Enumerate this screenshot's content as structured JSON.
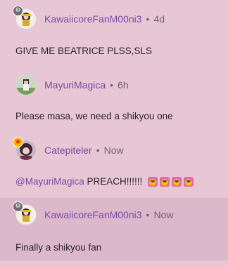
{
  "comments": [
    {
      "username": "KawaiicoreFanM00ni3",
      "separator": "•",
      "time": "4d",
      "text": "GIVE ME BEATRICE PLSS,SLS",
      "avatar_icon": "anime-character-avatar-icon",
      "badge": "gray-badge-icon"
    },
    {
      "username": "MayuriMagica",
      "separator": "•",
      "time": "6h",
      "text": "Please masa, we need a shikyou one",
      "avatar_icon": "pixel-character-avatar-icon"
    },
    {
      "username": "Catepiteler",
      "separator": "•",
      "time": "Now",
      "mention": "@MayuriMagica",
      "text": " PREACH!!!!!!",
      "emoji_count": 4,
      "avatar_icon": "dark-hair-avatar-icon",
      "badge": "star-badge-icon"
    },
    {
      "username": "KawaiicoreFanM00ni3",
      "separator": "•",
      "time": "Now",
      "text": "Finally a shikyou fan",
      "avatar_icon": "anime-character-avatar-icon",
      "badge": "gray-badge-icon",
      "highlighted": true
    }
  ],
  "colors": {
    "background": "#e8c7d4",
    "highlight": "#dcb8cb",
    "username": "#7a4aa6",
    "text": "#2b2230",
    "meta": "#6d6272"
  }
}
